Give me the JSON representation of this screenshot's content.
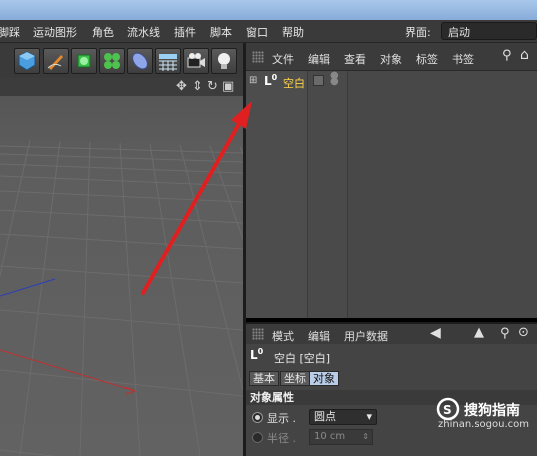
{
  "menubar": {
    "items": [
      "脚踩",
      "运动图形",
      "角色",
      "流水线",
      "插件",
      "脚本",
      "窗口",
      "帮助"
    ],
    "layout_label": "界面:",
    "layout_value": "启动"
  },
  "toolbar": {
    "tools": [
      "cube-icon",
      "pen-icon",
      "subdivision-icon",
      "cloner-icon",
      "deformer-icon",
      "floor-icon",
      "camera-icon",
      "light-icon"
    ]
  },
  "object_manager": {
    "menu": [
      "文件",
      "编辑",
      "查看",
      "对象",
      "标签",
      "书签"
    ],
    "object_name": "空白"
  },
  "attributes": {
    "menu": [
      "模式",
      "编辑",
      "用户数据"
    ],
    "object_title": "空白 [空白]",
    "tabs": [
      "基本",
      "坐标",
      "对象"
    ],
    "active_tab": "对象",
    "section_title": "对象属性",
    "display_label": "显示 .",
    "display_value": "圆点",
    "radius_label": "半径 .",
    "radius_value": "10 cm"
  },
  "watermark": {
    "title": "搜狗指南",
    "url": "zhinan.sogou.com"
  },
  "colors": {
    "annotation_arrow": "#e02020",
    "selected_object": "#ffd54a",
    "active_tab": "#b9cde8"
  }
}
